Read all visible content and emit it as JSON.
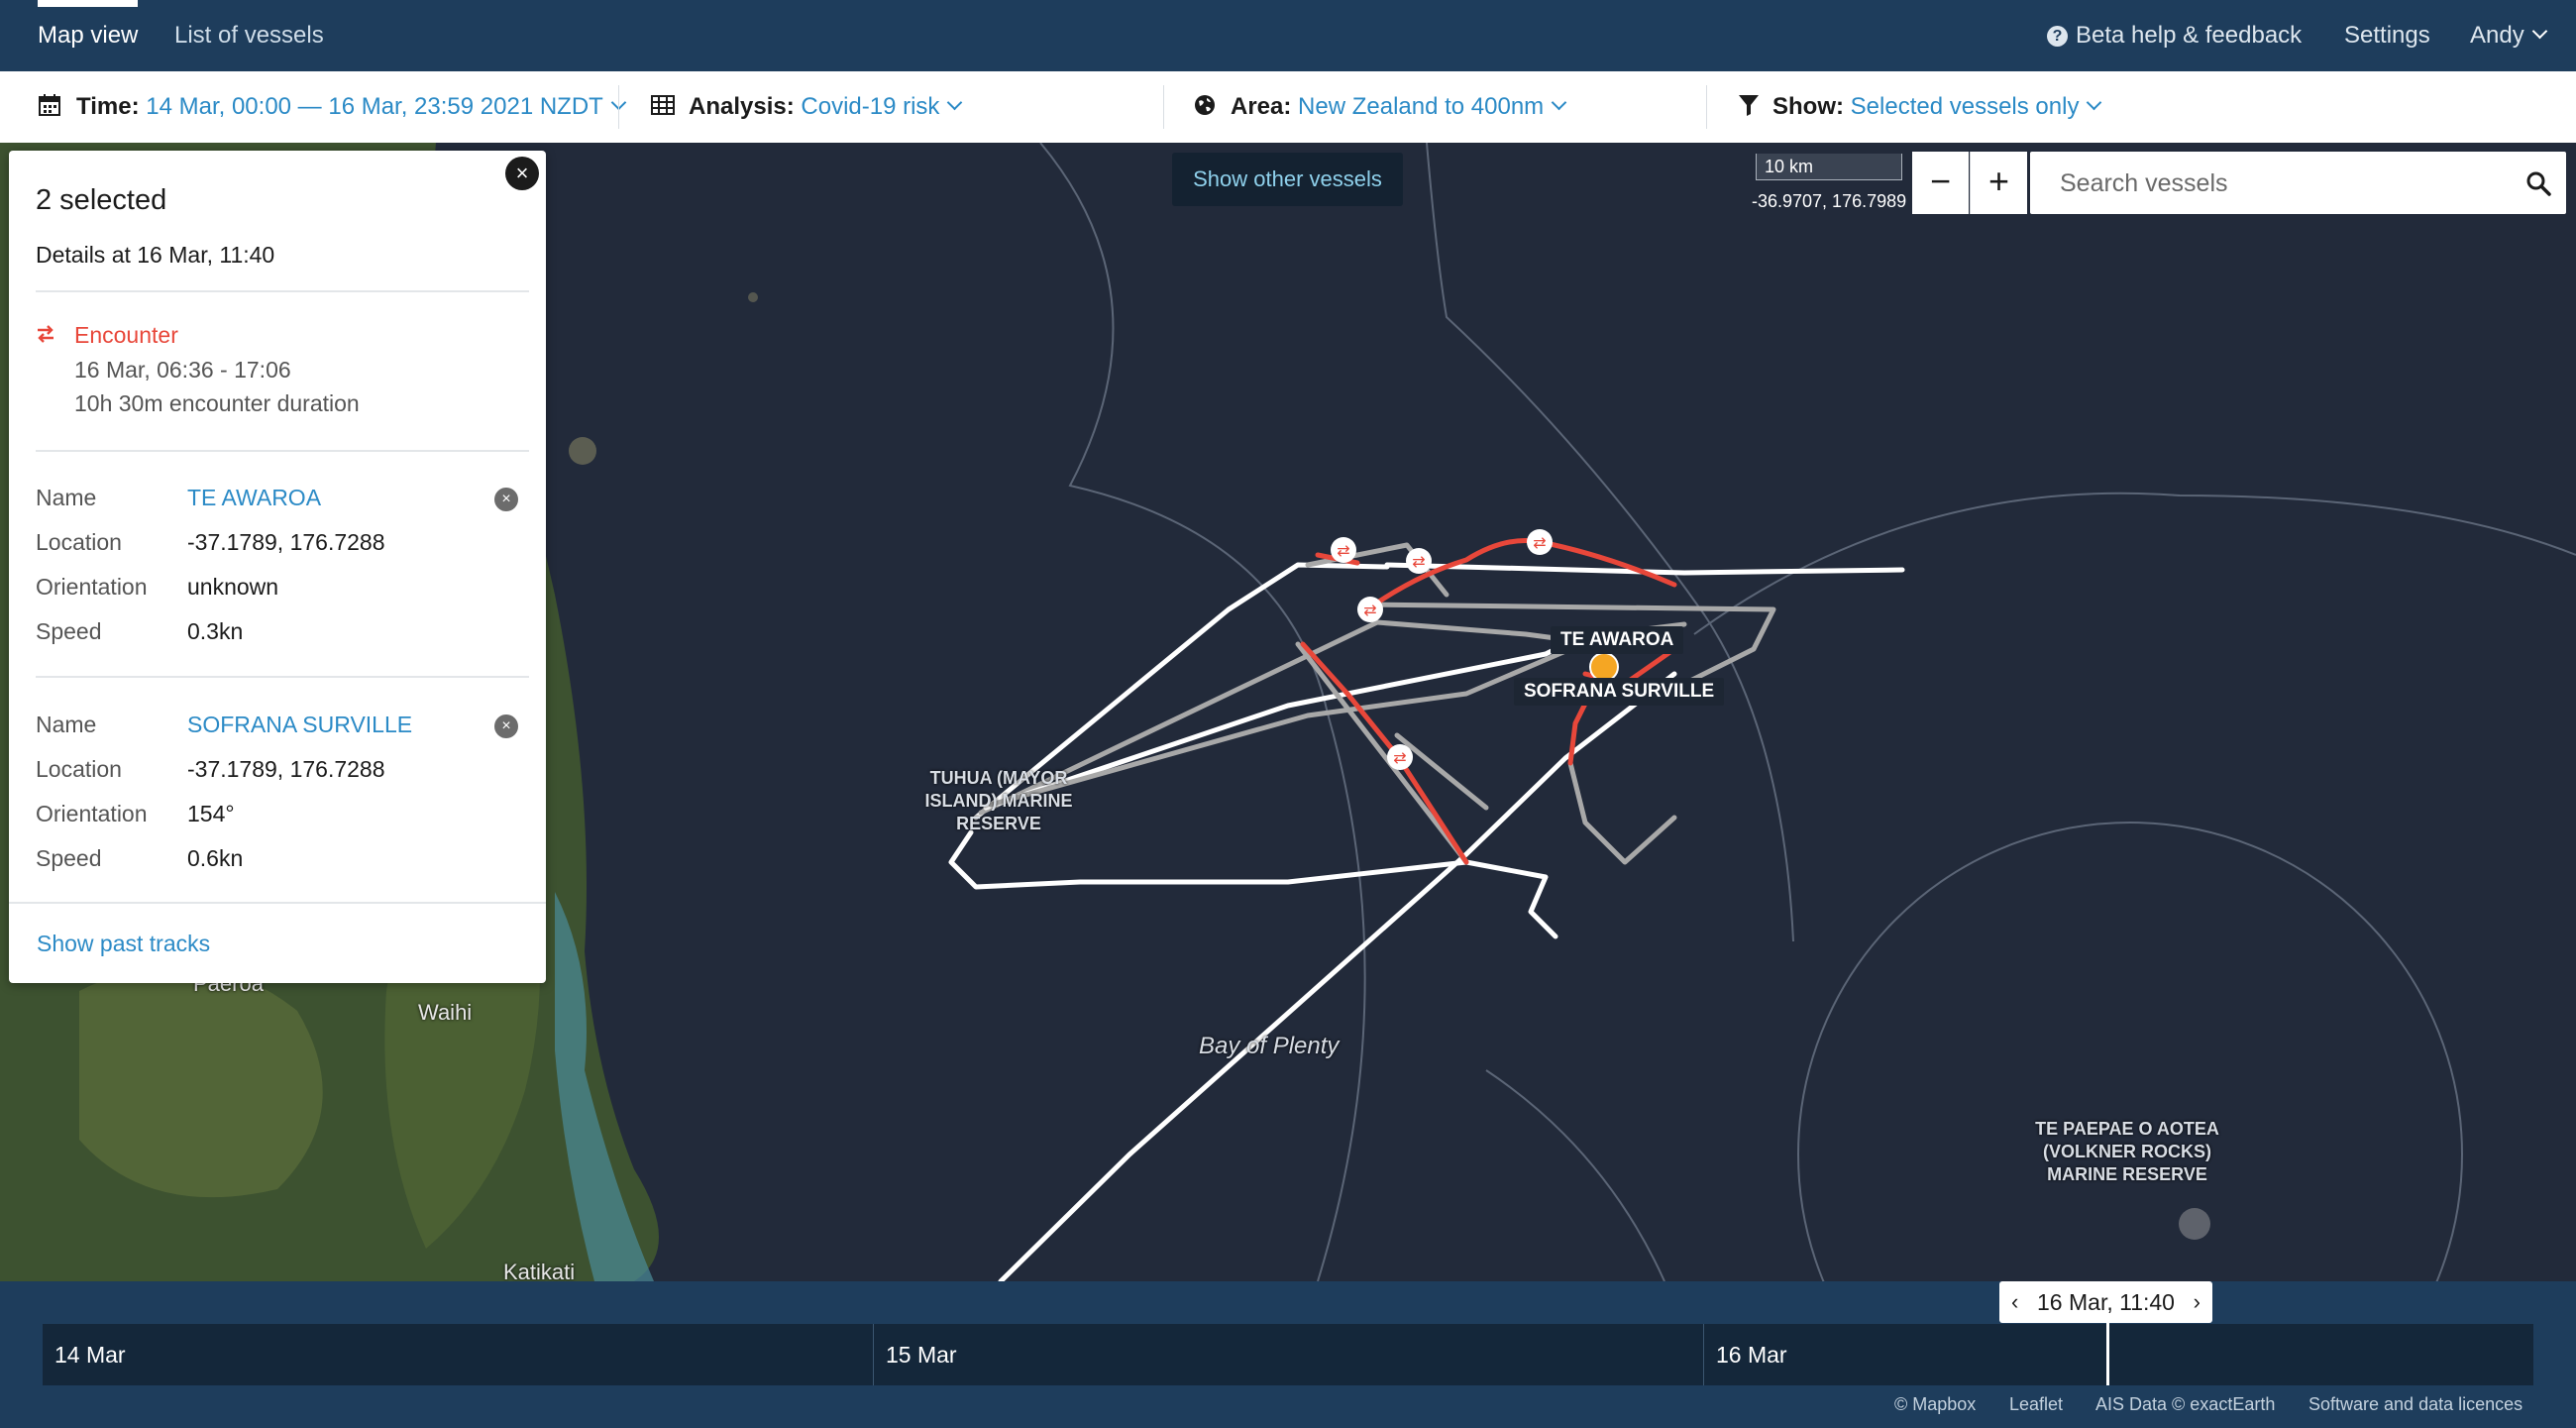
{
  "nav": {
    "tabs": [
      {
        "label": "Map view",
        "active": true
      },
      {
        "label": "List of vessels",
        "active": false
      }
    ],
    "help_label": "Beta help & feedback",
    "settings_label": "Settings",
    "user_label": "Andy"
  },
  "filters": {
    "time": {
      "label": "Time:",
      "value": "14 Mar, 00:00 — 16 Mar, 23:59 2021 NZDT"
    },
    "analysis": {
      "label": "Analysis:",
      "value": "Covid-19 risk"
    },
    "area": {
      "label": "Area:",
      "value": "New Zealand to 400nm"
    },
    "show": {
      "label": "Show:",
      "value": "Selected vessels only"
    }
  },
  "panel": {
    "title": "2 selected",
    "details_at": "Details at 16 Mar, 11:40",
    "close_symbol": "×",
    "remove_symbol": "×",
    "encounter": {
      "label": "Encounter",
      "time_range": "16 Mar, 06:36 - 17:06",
      "duration": "10h 30m encounter duration"
    },
    "field_labels": {
      "name": "Name",
      "location": "Location",
      "orientation": "Orientation",
      "speed": "Speed"
    },
    "vessels": [
      {
        "name": "TE AWAROA",
        "location": "-37.1789, 176.7288",
        "orientation": "unknown",
        "speed": "0.3kn"
      },
      {
        "name": "SOFRANA SURVILLE",
        "location": "-37.1789, 176.7288",
        "orientation": "154°",
        "speed": "0.6kn"
      }
    ],
    "past_tracks_label": "Show past tracks"
  },
  "map": {
    "show_other_label": "Show other vessels",
    "scale_label": "10 km",
    "coordinates": "-36.9707, 176.7989",
    "zoom_out_label": "−",
    "zoom_in_label": "+",
    "search_placeholder": "Search vessels",
    "vessel_labels": [
      "TE AWAROA",
      "SOFRANA SURVILLE"
    ],
    "place_labels": {
      "tuhua": "TUHUA (MAYOR ISLAND) MARINE RESERVE",
      "bay": "Bay of Plenty",
      "te_paepae": "TE PAEPAE O AOTEA (VOLKNER ROCKS) MARINE RESERVE",
      "paeroa": "Paeroa",
      "waihi": "Waihi",
      "katikati": "Katikati"
    }
  },
  "timeline": {
    "days": [
      "14 Mar",
      "15 Mar",
      "16 Mar"
    ],
    "current": "16 Mar, 11:40",
    "current_fraction": 0.833
  },
  "footer": {
    "links": [
      "© Mapbox",
      "Leaflet",
      "AIS Data © exactEarth",
      "Software and data licences"
    ]
  },
  "colors": {
    "nav_bg": "#1e3d5c",
    "link": "#2b8ac6",
    "encounter": "#e8473a",
    "track": "#ffffff",
    "map_sea": "#222a3a"
  },
  "icons": {
    "time": "calendar-icon",
    "analysis": "table-icon",
    "area": "globe-icon",
    "show": "filter-icon",
    "search": "search-icon",
    "encounter": "encounter-arrows-icon"
  }
}
